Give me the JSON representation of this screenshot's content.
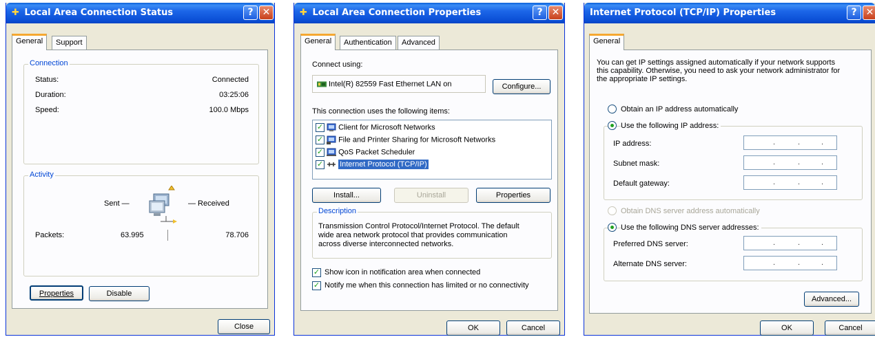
{
  "status_window": {
    "title": "Local Area Connection Status",
    "tabs": [
      "General",
      "Support"
    ],
    "connection_group": "Connection",
    "status_label": "Status:",
    "status_value": "Connected",
    "duration_label": "Duration:",
    "duration_value": "03:25:06",
    "speed_label": "Speed:",
    "speed_value": "100.0 Mbps",
    "activity_group": "Activity",
    "sent_label": "Sent —",
    "received_label": "— Received",
    "packets_label": "Packets:",
    "packets_sent": "63.995",
    "packets_received": "78.706",
    "properties_button": "Properties",
    "disable_button": "Disable",
    "close_button": "Close"
  },
  "properties_window": {
    "title": "Local Area Connection Properties",
    "tabs": [
      "General",
      "Authentication",
      "Advanced"
    ],
    "connect_using_label": "Connect using:",
    "adapter": "Intel(R) 82559 Fast Ethernet LAN on",
    "configure_button": "Configure...",
    "items_label": "This connection uses the following items:",
    "items": [
      {
        "label": "Client for Microsoft Networks",
        "checked": true
      },
      {
        "label": "File and Printer Sharing for Microsoft Networks",
        "checked": true
      },
      {
        "label": "QoS Packet Scheduler",
        "checked": true
      },
      {
        "label": "Internet Protocol (TCP/IP)",
        "checked": true,
        "selected": true
      }
    ],
    "install_button": "Install...",
    "uninstall_button": "Uninstall",
    "properties_button": "Properties",
    "description_group": "Description",
    "description_lines": [
      "Transmission Control Protocol/Internet Protocol. The default",
      "wide area network protocol that provides communication",
      "across diverse interconnected networks."
    ],
    "show_icon_label": "Show icon in notification area when connected",
    "notify_label": "Notify me when this connection has limited or no connectivity",
    "ok_button": "OK",
    "cancel_button": "Cancel"
  },
  "tcpip_window": {
    "title": "Internet Protocol (TCP/IP) Properties",
    "tabs": [
      "General"
    ],
    "intro_lines": [
      "You can get IP settings assigned automatically if your network supports",
      "this capability. Otherwise, you need to ask your network administrator for",
      "the appropriate IP settings."
    ],
    "obtain_ip_auto": "Obtain an IP address automatically",
    "use_following_ip": "Use the following IP address:",
    "ip_address_label": "IP address:",
    "subnet_mask_label": "Subnet mask:",
    "default_gateway_label": "Default gateway:",
    "obtain_dns_auto": "Obtain DNS server address automatically",
    "use_following_dns": "Use the following DNS server addresses:",
    "preferred_dns_label": "Preferred DNS server:",
    "alternate_dns_label": "Alternate DNS server:",
    "advanced_button": "Advanced...",
    "ok_button": "OK",
    "cancel_button": "Cancel"
  },
  "colors": {
    "titlebar": "#0a4fd6",
    "dialog_bg": "#ece9d8",
    "group_label": "#0046d5",
    "selected_item": "#316ac5"
  }
}
